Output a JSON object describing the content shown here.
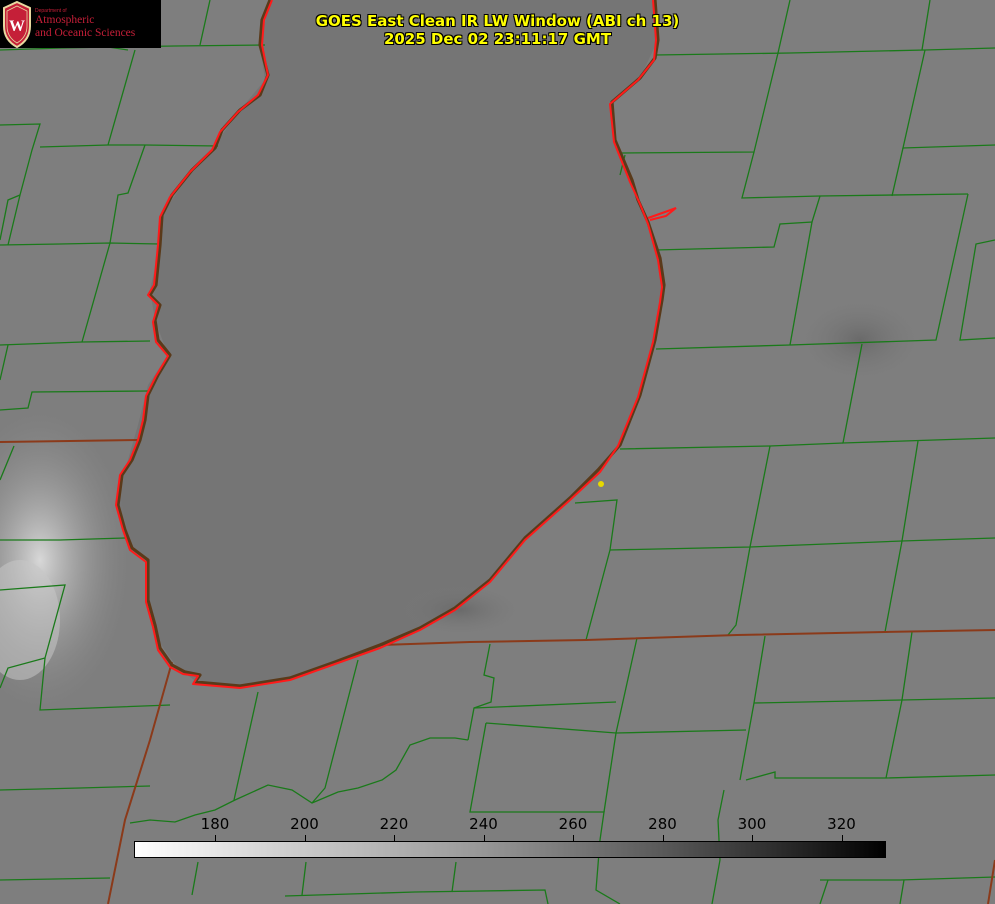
{
  "title": {
    "line1": "GOES East Clean IR LW Window (ABI ch 13)",
    "line2": "2025 Dec 02 23:11:17 GMT"
  },
  "logo": {
    "department": "Department of",
    "line1": "Atmospheric",
    "line2": "and Oceanic Sciences",
    "crest_letter": "W",
    "icon": "uw-crest-icon"
  },
  "colorbar": {
    "ticks": [
      "180",
      "200",
      "220",
      "240",
      "260",
      "280",
      "300",
      "320"
    ],
    "unit": ""
  },
  "colors": {
    "title": "#ffff00",
    "county_lines": "#1a7a1a",
    "coastline": "#ff1a1a",
    "state_border": "#8b3a1a",
    "marker": "#e6d800",
    "background": "#7f7f7f",
    "logo_text": "#c51f38"
  }
}
